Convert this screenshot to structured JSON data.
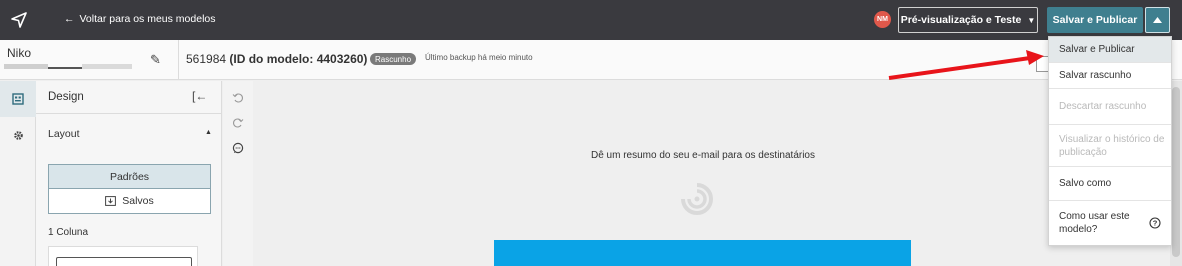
{
  "topbar": {
    "back_label": "Voltar para os meus modelos",
    "back_icon": "arrow-left-icon",
    "send_icon": "paper-plane-icon",
    "avatar_initials": "NM",
    "preview_label": "Pré-visualização e Teste",
    "publish_label": "Salvar e Publicar"
  },
  "infobar": {
    "model_name": "Niko",
    "model_number": "561984",
    "model_id_label": "(ID do modelo: 4403260)",
    "status_badge": "Rascunho",
    "backup_text": "Último backup há meio minuto"
  },
  "design_panel": {
    "title": "Design",
    "layout_label": "Layout",
    "tab_defaults": "Padrões",
    "tab_saved": "Salvos",
    "column_label": "1 Coluna"
  },
  "canvas": {
    "summary_text": "Dê um resumo do seu e-mail para os destinatários"
  },
  "dropdown": {
    "items": [
      {
        "label": "Salvar e Publicar",
        "state": "active"
      },
      {
        "label": "Salvar rascunho",
        "state": "normal"
      },
      {
        "label": "Descartar rascunho",
        "state": "disabled"
      },
      {
        "label": "Visualizar o histórico de publicação",
        "state": "disabled"
      },
      {
        "label": "Salvo como",
        "state": "normal"
      },
      {
        "label": "Como usar este modelo?",
        "state": "normal"
      }
    ]
  },
  "colors": {
    "topbar_bg": "#3a3a3f",
    "accent": "#3f7f8f",
    "avatar_bg": "#e0584b",
    "annotation_arrow": "#e8141a",
    "email_header_blue": "#0aa3e6"
  }
}
